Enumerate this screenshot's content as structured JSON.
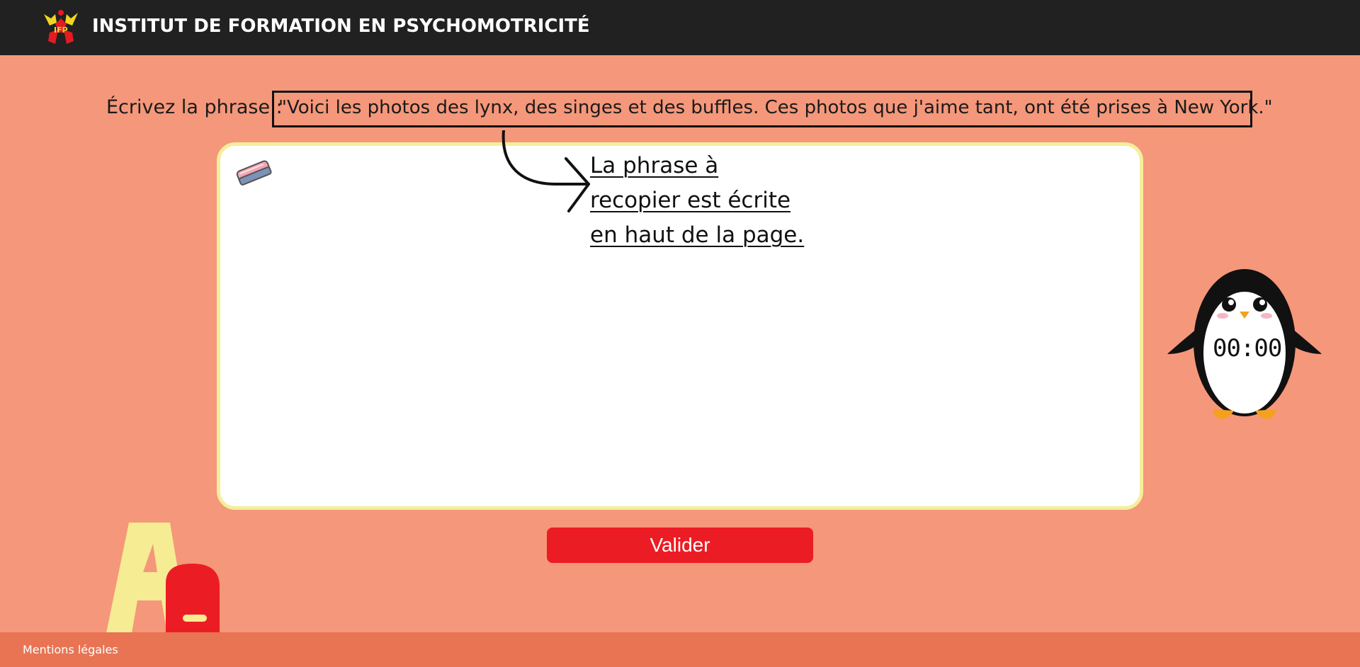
{
  "header": {
    "title": "INSTITUT DE FORMATION EN PSYCHOMOTRICITÉ",
    "logo_icon": "ifp-logo-icon",
    "background": "#212121"
  },
  "exercise": {
    "prompt_label": "Écrivez la phrase : ",
    "target_sentence": "\"Voici les photos des lynx, des singes et des buffles. Ces photos que j'aime tant, ont été prises à New York.\"",
    "hint_lines": [
      "La phrase à",
      "recopier est écrite",
      "en haut de la page."
    ],
    "eraser_icon": "eraser-icon",
    "arrow_icon": "curved-arrow-icon"
  },
  "actions": {
    "validate_label": "Valider",
    "validate_color": "#ec1c24"
  },
  "timer": {
    "value": "00:00",
    "mascot_icon": "penguin-icon"
  },
  "decoration": {
    "letters_icon": "aa-letters-icon"
  },
  "footer": {
    "legal_link": "Mentions légales",
    "background": "#e87454"
  },
  "colors": {
    "page_background": "#f5977a",
    "writing_border": "#f3ef9b"
  }
}
